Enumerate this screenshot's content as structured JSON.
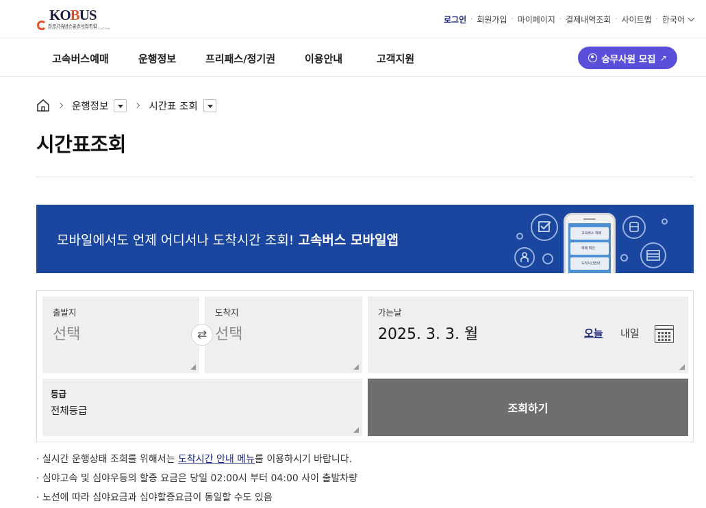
{
  "logo": {
    "mark_ko": "KO",
    "mark_b": "B",
    "mark_u": "U",
    "mark_s": "S",
    "subtitle": "전국고속버스운송사업조합",
    "subtitle_en": "KOREA EXPRESS BUS LINES ASSOCIATION"
  },
  "util_nav": {
    "login": "로그인",
    "join": "회원가입",
    "mypage": "마이페이지",
    "payments": "결제내역조회",
    "sitemap": "사이트맵",
    "language": "한국어"
  },
  "gnb": {
    "items": [
      "고속버스예매",
      "운행정보",
      "프리패스/정기권",
      "이용안내",
      "고객지원"
    ],
    "recruit_button": "승무사원 모집",
    "recruit_arrow": "↗"
  },
  "breadcrumb": {
    "level1": "운행정보",
    "level2": "시간표 조회"
  },
  "page_title": "시간표조회",
  "banner": {
    "text": "모바일에서도 언제 어디서나 도착시간 조회!",
    "emphasis": "고속버스 모바일앱",
    "phone_rows": [
      "고속버스 예매",
      "예매 확인",
      "도착시간안내"
    ]
  },
  "form": {
    "departure": {
      "label": "출발지",
      "value": "선택"
    },
    "arrival": {
      "label": "도착지",
      "value": "선택"
    },
    "swap_icon": "⇄",
    "date": {
      "label": "가는날",
      "value": "2025. 3. 3. 월",
      "today": "오늘",
      "tomorrow": "내일"
    },
    "grade": {
      "label": "등급",
      "value": "전체등급"
    },
    "search_button": "조회하기"
  },
  "notices": {
    "line1_pre": "· 실시간 운행상태 조회를 위해서는 ",
    "line1_link": "도착시간 안내 메뉴",
    "line1_post": "를 이용하시기 바랍니다.",
    "line2": "· 심야고속 및 심야우등의 할증 요금은 당일 02:00시 부터 04:00 사이 출발차량",
    "line3": "· 노선에 따라 심야요금과 심야할증요금이 동일할 수도 있음"
  },
  "colors": {
    "brand_navy": "#1b2a7c",
    "accent_purple": "#5a4fd8",
    "banner_blue": "#1a46a0",
    "logo_orange": "#e0502a",
    "search_button_gray": "#6e6e6e"
  }
}
